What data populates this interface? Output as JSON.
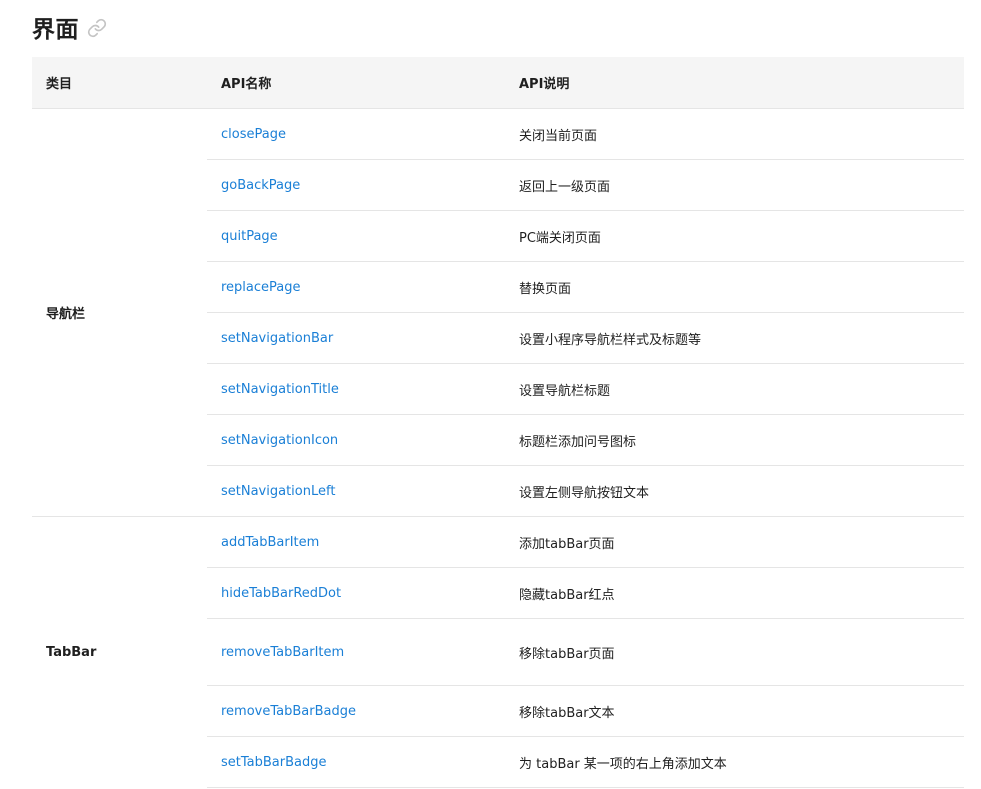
{
  "section": {
    "title": "界面",
    "anchor_icon": "link-icon"
  },
  "table": {
    "headers": {
      "category": "类目",
      "api_name": "API名称",
      "api_desc": "API说明"
    },
    "groups": [
      {
        "category": "导航栏",
        "rows": [
          {
            "name": "closePage",
            "desc": "关闭当前页面"
          },
          {
            "name": "goBackPage",
            "desc": "返回上一级页面"
          },
          {
            "name": "quitPage",
            "desc": "PC端关闭页面"
          },
          {
            "name": "replacePage",
            "desc": "替换页面"
          },
          {
            "name": "setNavigationBar",
            "desc": "设置小程序导航栏样式及标题等"
          },
          {
            "name": "setNavigationTitle",
            "desc": "设置导航栏标题"
          },
          {
            "name": "setNavigationIcon",
            "desc": "标题栏添加问号图标"
          },
          {
            "name": "setNavigationLeft",
            "desc": "设置左侧导航按钮文本"
          }
        ]
      },
      {
        "category": "TabBar",
        "rows": [
          {
            "name": "addTabBarItem",
            "desc": "添加tabBar页面"
          },
          {
            "name": "hideTabBarRedDot",
            "desc": "隐藏tabBar红点"
          },
          {
            "name": "removeTabBarItem",
            "desc": "移除tabBar页面"
          },
          {
            "name": "removeTabBarBadge",
            "desc": "移除tabBar文本"
          },
          {
            "name": "setTabBarBadge",
            "desc": "为 tabBar 某一项的右上角添加文本"
          }
        ]
      }
    ]
  }
}
